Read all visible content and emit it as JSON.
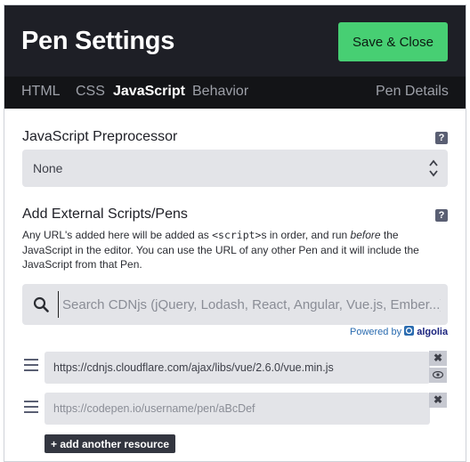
{
  "header": {
    "title": "Pen Settings",
    "save_label": "Save & Close"
  },
  "tabs": [
    {
      "label": "HTML"
    },
    {
      "label": "CSS"
    },
    {
      "label": "JavaScript",
      "active": true
    },
    {
      "label": "Behavior"
    },
    {
      "label": "Pen Details"
    }
  ],
  "preprocessor": {
    "title": "JavaScript Preprocessor",
    "help": "?",
    "value": "None"
  },
  "external": {
    "title": "Add External Scripts/Pens",
    "help": "?",
    "desc_1": "Any URL's added here will be added as ",
    "desc_code": "<script>",
    "desc_2": "s in order, and run ",
    "desc_em": "before",
    "desc_3": " the JavaScript in the editor. You can use the URL of any other Pen and it will include the JavaScript from that Pen.",
    "search_placeholder": "Search CDNjs (jQuery, Lodash, React, Angular, Vue.js, Ember...)",
    "powered_by": "Powered by",
    "powered_brand": "algolia"
  },
  "resources": [
    {
      "value": "https://cdnjs.cloudflare.com/ajax/libs/vue/2.6.0/vue.min.js",
      "placeholder": ""
    },
    {
      "value": "",
      "placeholder": "https://codepen.io/username/pen/aBcDef"
    }
  ],
  "add_resource_label": "+ add another resource",
  "colors": {
    "header_bg": "#1e1f26",
    "tab_bar_bg": "#131417",
    "save_button": "#47cf73",
    "field_bg": "#e3e4e8"
  }
}
